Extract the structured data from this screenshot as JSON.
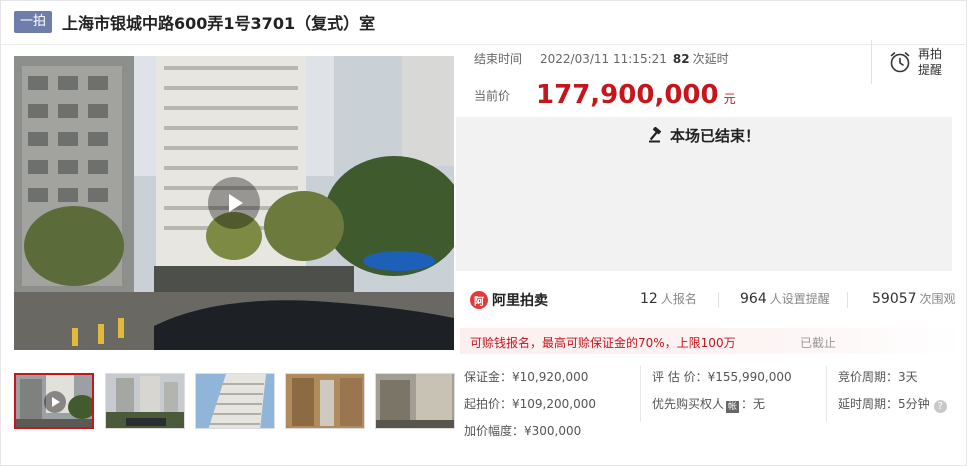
{
  "header": {
    "badge": "一拍",
    "title": "上海市银城中路600弄1号3701（复式）室"
  },
  "auction": {
    "end_time_label": "结束时间",
    "end_time_value": "2022/03/11 11:15:21",
    "extension_count": "82",
    "extension_label": "次延时",
    "current_price_label": "当前价",
    "current_price": "177,900,000",
    "currency_unit": "元",
    "remind_label": "再拍提醒",
    "ended_message": "本场已结束！"
  },
  "platform": {
    "logo_mark": "阿",
    "name": "阿里拍卖"
  },
  "stats": {
    "signups": "12",
    "signups_label": "人报名",
    "reminders": "964",
    "reminders_label": "人设置提醒",
    "views": "59057",
    "views_label": "次围观"
  },
  "notice": {
    "text": "可赊钱报名，最高可赊保证金的70%，上限100万",
    "status": "已截止"
  },
  "details": {
    "deposit_label": "保证金：",
    "deposit_value": "¥10,920,000",
    "start_price_label": "起拍价：",
    "start_price_value": "¥109,200,000",
    "increment_label": "加价幅度：",
    "increment_value": "¥300,000",
    "appraisal_label": "评 估 价：",
    "appraisal_value": "¥155,990,000",
    "priority_label": "优先购买权人",
    "priority_tag": "帐",
    "priority_value": "：无",
    "cycle_label": "竞价周期：",
    "cycle_value": "3天",
    "delay_label": "延时周期：",
    "delay_value": "5分钟"
  },
  "thumbnails": [
    {
      "kind": "video",
      "active": true
    },
    {
      "kind": "photo",
      "active": false
    },
    {
      "kind": "photo",
      "active": false
    },
    {
      "kind": "photo",
      "active": false
    },
    {
      "kind": "photo",
      "active": false
    }
  ],
  "colors": {
    "accent": "#c4161c",
    "badge": "#6f7dab",
    "ended_bg": "#f2f2f2"
  },
  "icons": {
    "play": "play-icon",
    "clock": "alarm-clock-icon",
    "gavel": "gavel-icon",
    "help": "question-icon"
  }
}
